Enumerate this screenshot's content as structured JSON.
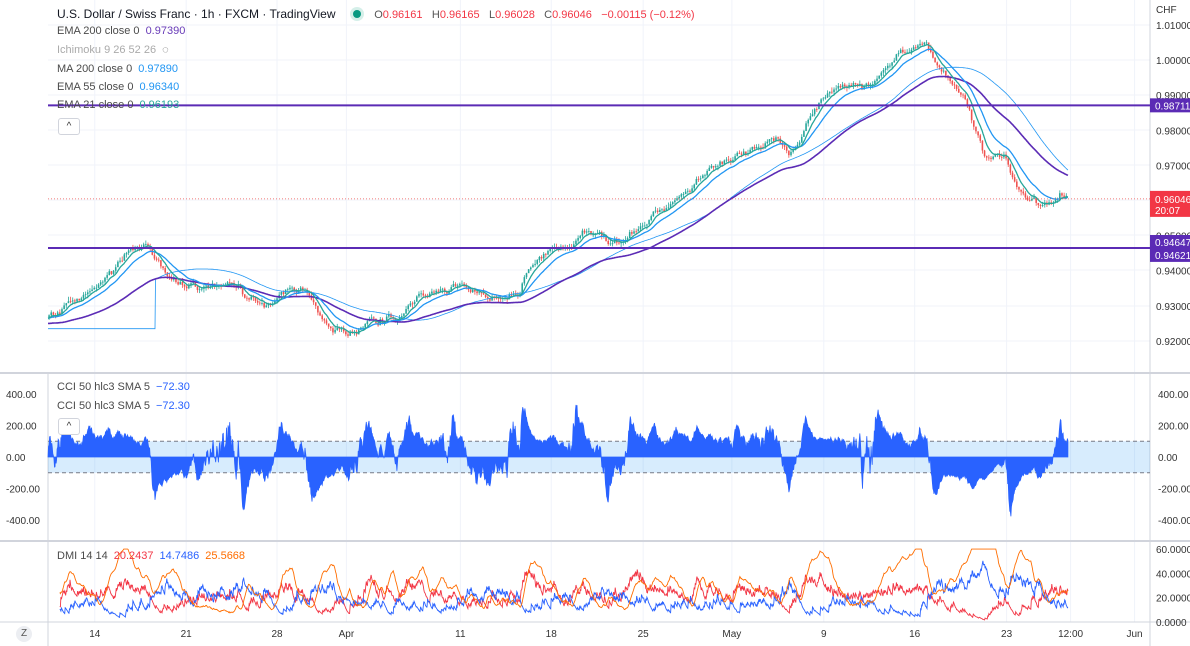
{
  "header": {
    "title": "U.S. Dollar / Swiss Franc · 1h · FXCM · TradingView",
    "status_color": "#089981",
    "o_label": "O",
    "o": "0.96161",
    "h_label": "H",
    "h": "0.96165",
    "l_label": "L",
    "l": "0.96028",
    "c_label": "C",
    "c": "0.96046",
    "change": "−0.00115 (−0.12%)"
  },
  "legend": [
    {
      "name": "EMA 200 close 0",
      "value": "0.97390",
      "color": "#673ab7"
    },
    {
      "name": "Ichimoku 9 26 52 26",
      "value": "",
      "color": "#999"
    },
    {
      "name": "MA 200 close 0",
      "value": "0.97890",
      "color": "#2196f3"
    },
    {
      "name": "EMA 55 close 0",
      "value": "0.96340",
      "color": "#2196f3"
    },
    {
      "name": "EMA 21 close 0",
      "value": "0.96193",
      "color": "#26a69a"
    }
  ],
  "price_scale": {
    "currency": "CHF",
    "ticks": [
      "1.01000",
      "1.00000",
      "0.99000",
      "0.98000",
      "0.97000",
      "0.95000",
      "0.94000",
      "0.93000",
      "0.92000"
    ],
    "last_price": "0.96046",
    "countdown": "20:07",
    "hlines": [
      "0.98711",
      "0.94647",
      "0.94621"
    ]
  },
  "cci": {
    "legend": [
      {
        "name": "CCI 50 hlc3 SMA 5",
        "value": "−72.30"
      },
      {
        "name": "CCI 50 hlc3 SMA 5",
        "value": "−72.30"
      }
    ],
    "ticks": [
      "400.00",
      "200.00",
      "0.00",
      "-200.00",
      "-400.00"
    ]
  },
  "dmi": {
    "name": "DMI 14 14",
    "plus": "20.2437",
    "minus": "14.7486",
    "adx": "25.5668",
    "ticks": [
      "60.0000",
      "40.0000",
      "20.0000",
      "0.0000"
    ]
  },
  "time_axis": {
    "labels": [
      "14",
      "21",
      "28",
      "Apr",
      "11",
      "18",
      "25",
      "May",
      "9",
      "16",
      "23",
      "12:00",
      "Jun"
    ],
    "zoom_button": "Z"
  },
  "chart_data": {
    "type": "candlestick",
    "symbol": "USDCHF",
    "timeframe": "1h",
    "ylim": [
      0.915,
      1.012
    ],
    "anchor_points": [
      [
        0,
        0.927
      ],
      [
        87,
        0.935
      ],
      [
        153,
        0.945
      ],
      [
        180,
        0.946
      ],
      [
        218,
        0.938
      ],
      [
        283,
        0.935
      ],
      [
        357,
        0.937
      ],
      [
        404,
        0.929
      ],
      [
        450,
        0.936
      ],
      [
        487,
        0.933
      ],
      [
        525,
        0.923
      ],
      [
        552,
        0.922
      ],
      [
        599,
        0.926
      ],
      [
        655,
        0.926
      ],
      [
        692,
        0.933
      ],
      [
        766,
        0.936
      ],
      [
        822,
        0.931
      ],
      [
        878,
        0.934
      ],
      [
        897,
        0.943
      ],
      [
        952,
        0.946
      ],
      [
        1008,
        0.952
      ],
      [
        1064,
        0.948
      ],
      [
        1138,
        0.957
      ],
      [
        1213,
        0.967
      ],
      [
        1287,
        0.972
      ],
      [
        1362,
        0.977
      ],
      [
        1380,
        0.972
      ],
      [
        1417,
        0.985
      ],
      [
        1473,
        0.993
      ],
      [
        1529,
        0.992
      ],
      [
        1585,
        1.003
      ],
      [
        1631,
        1.005
      ],
      [
        1668,
        0.996
      ],
      [
        1706,
        0.99
      ],
      [
        1743,
        0.973
      ],
      [
        1780,
        0.972
      ],
      [
        1808,
        0.963
      ],
      [
        1845,
        0.959
      ],
      [
        1897,
        0.9605
      ]
    ],
    "time_label_bars": [
      87,
      257,
      426,
      555,
      767,
      936,
      1107,
      1272,
      1443,
      1612,
      1783,
      1902,
      2021
    ],
    "hlines": [
      0.98711,
      0.94647,
      0.94621
    ],
    "last": 0.96046,
    "cci_ylim": [
      -500,
      500
    ],
    "cci_band": [
      -100,
      100
    ],
    "dmi_ylim": [
      0,
      62
    ]
  }
}
